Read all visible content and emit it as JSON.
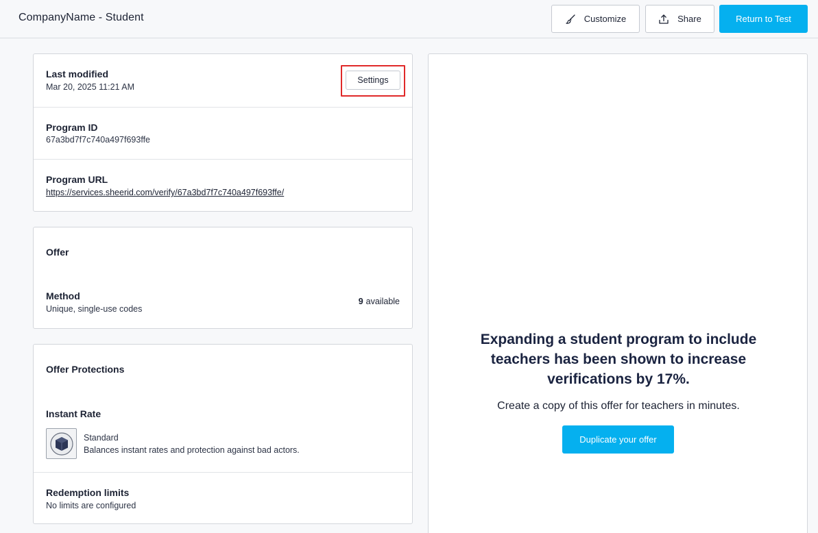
{
  "header": {
    "title": "CompanyName - Student",
    "customize_label": "Customize",
    "share_label": "Share",
    "return_label": "Return to Test",
    "customize_icon": "brush-icon",
    "share_icon": "upload-icon"
  },
  "program": {
    "last_modified_label": "Last modified",
    "last_modified_value": "Mar 20, 2025 11:21 AM",
    "settings_label": "Settings",
    "program_id_label": "Program ID",
    "program_id_value": "67a3bd7f7c740a497f693ffe",
    "program_url_label": "Program URL",
    "program_url_value": "https://services.sheerid.com/verify/67a3bd7f7c740a497f693ffe/"
  },
  "offer": {
    "title": "Offer",
    "method_label": "Method",
    "method_value": "Unique, single-use codes",
    "available_count": "9",
    "available_label": "available"
  },
  "protections": {
    "title": "Offer Protections",
    "instant_rate_label": "Instant Rate",
    "rate_name": "Standard",
    "rate_description": "Balances instant rates and protection against bad actors.",
    "rate_icon": "shield-icon",
    "redemption_label": "Redemption limits",
    "redemption_value": "No limits are configured"
  },
  "promo": {
    "heading": "Expanding a student program to include teachers has been shown to increase verifications by 17%.",
    "subtext": "Create a copy of this offer for teachers in minutes.",
    "button_label": "Duplicate your offer"
  },
  "colors": {
    "primary": "#05b0ef",
    "highlight": "#e02828",
    "background": "#f7f8fa"
  }
}
